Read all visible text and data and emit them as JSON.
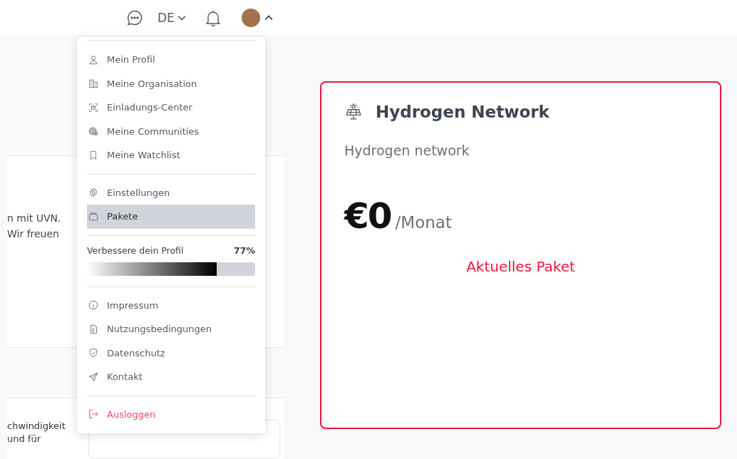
{
  "header": {
    "language": "DE",
    "user_menu_expanded": true
  },
  "left_panel": {
    "intro_lines": [
      "n mit UVN.",
      "Wir freuen"
    ],
    "feature_lines": [
      "chwindigkeit",
      "und für"
    ]
  },
  "menu": {
    "sections": [
      {
        "kind": "links",
        "items": [
          {
            "label": "Mein Profil",
            "selected": false
          },
          {
            "label": "Meine Organisation",
            "selected": false
          },
          {
            "label": "Einladungs-Center",
            "selected": false
          },
          {
            "label": "Meine Communities",
            "selected": false
          },
          {
            "label": "Meine Watchlist",
            "selected": false
          }
        ]
      },
      {
        "kind": "links",
        "items": [
          {
            "label": "Einstellungen",
            "selected": false
          },
          {
            "label": "Pakete",
            "selected": true
          }
        ]
      },
      {
        "kind": "progress",
        "label": "Verbessere dein Profil",
        "reading": "77%",
        "level": 0.77
      },
      {
        "kind": "links",
        "items": [
          {
            "label": "Impressum",
            "selected": false
          },
          {
            "label": "Nutzungsbedingungen",
            "selected": false
          },
          {
            "label": "Datenschutz",
            "selected": false
          },
          {
            "label": "Kontakt",
            "selected": false
          }
        ]
      },
      {
        "kind": "logout",
        "label": "Ausloggen"
      }
    ]
  },
  "plan_card": {
    "title": "Hydrogen Network",
    "subtitle": "Hydrogen network",
    "price": "€0",
    "period": "/Monat",
    "status": "Aktuelles Paket",
    "current": true
  }
}
